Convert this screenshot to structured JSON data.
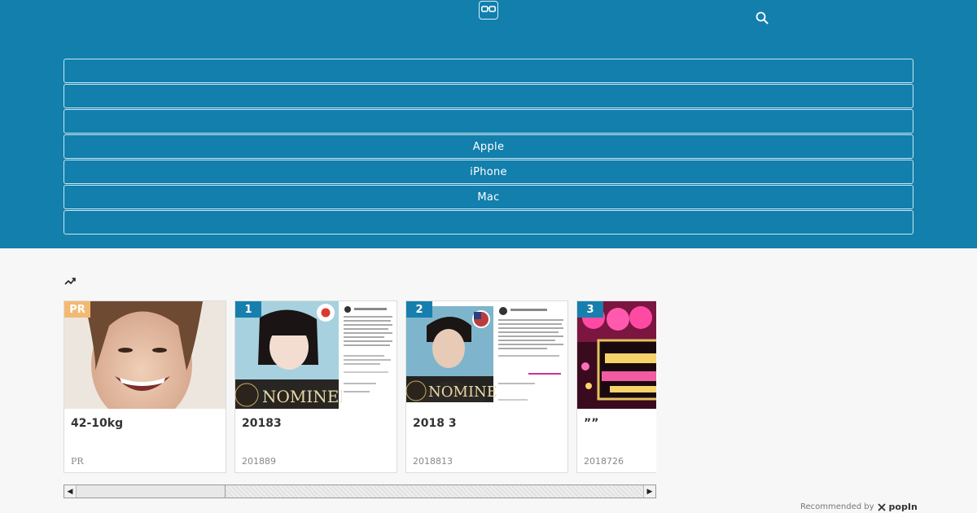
{
  "header": {
    "logo_icon": "glasses-icon",
    "search_icon": "search-icon",
    "background": "#127fad"
  },
  "nav": {
    "items": [
      {
        "label": ""
      },
      {
        "label": ""
      },
      {
        "label": ""
      },
      {
        "label": "Apple"
      },
      {
        "label": "iPhone"
      },
      {
        "label": "Mac"
      },
      {
        "label": ""
      }
    ]
  },
  "trending": {
    "icon": "trending-up-icon"
  },
  "cards": [
    {
      "badge": "PR",
      "badge_color": "#f3b972",
      "title": "42-10kg",
      "meta": "PR"
    },
    {
      "badge": "1",
      "badge_color": "#177fad",
      "title": "20183",
      "meta": "201889"
    },
    {
      "badge": "2",
      "badge_color": "#177fad",
      "title": "2018 3",
      "meta": "2018813"
    },
    {
      "badge": "3",
      "badge_color": "#177fad",
      "title": "””",
      "meta": "2018726"
    }
  ],
  "thumb_text": {
    "nominee": "NOMINEE",
    "nominee2": "NOMINEE"
  },
  "footer": {
    "recommended_by": "Recommended by",
    "brand": "popIn"
  }
}
